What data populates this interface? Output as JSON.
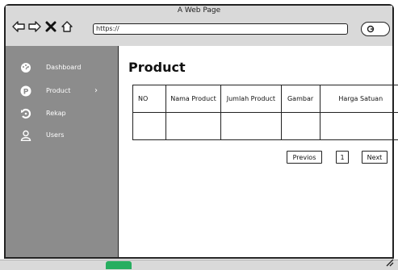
{
  "window": {
    "title": "A Web Page"
  },
  "toolbar": {
    "back_icon": "back-arrow-icon",
    "forward_icon": "forward-arrow-icon",
    "close_icon": "close-x-icon",
    "home_icon": "home-icon",
    "url": "https://",
    "search_icon": "search-icon"
  },
  "sidebar": {
    "items": [
      {
        "label": "Dashboard",
        "icon": "dashboard-gauge-icon"
      },
      {
        "label": "Product",
        "icon": "p-circle-icon",
        "has_submenu": true
      },
      {
        "label": "Rekap",
        "icon": "history-icon"
      },
      {
        "label": "Users",
        "icon": "user-icon"
      }
    ]
  },
  "main": {
    "title": "Product",
    "table": {
      "columns": [
        "NO",
        "Nama Product",
        "Jumlah Product",
        "Gambar",
        "Harga Satuan"
      ],
      "rows": [
        [
          "",
          "",
          "",
          "",
          ""
        ]
      ]
    },
    "pagination": {
      "prev_label": "Previos",
      "page_label": "1",
      "next_label": "Next"
    }
  },
  "colors": {
    "sidebar_bg": "#8c8c8c",
    "chrome_bg": "#d9d9d9",
    "accent_green": "#27ae60"
  }
}
